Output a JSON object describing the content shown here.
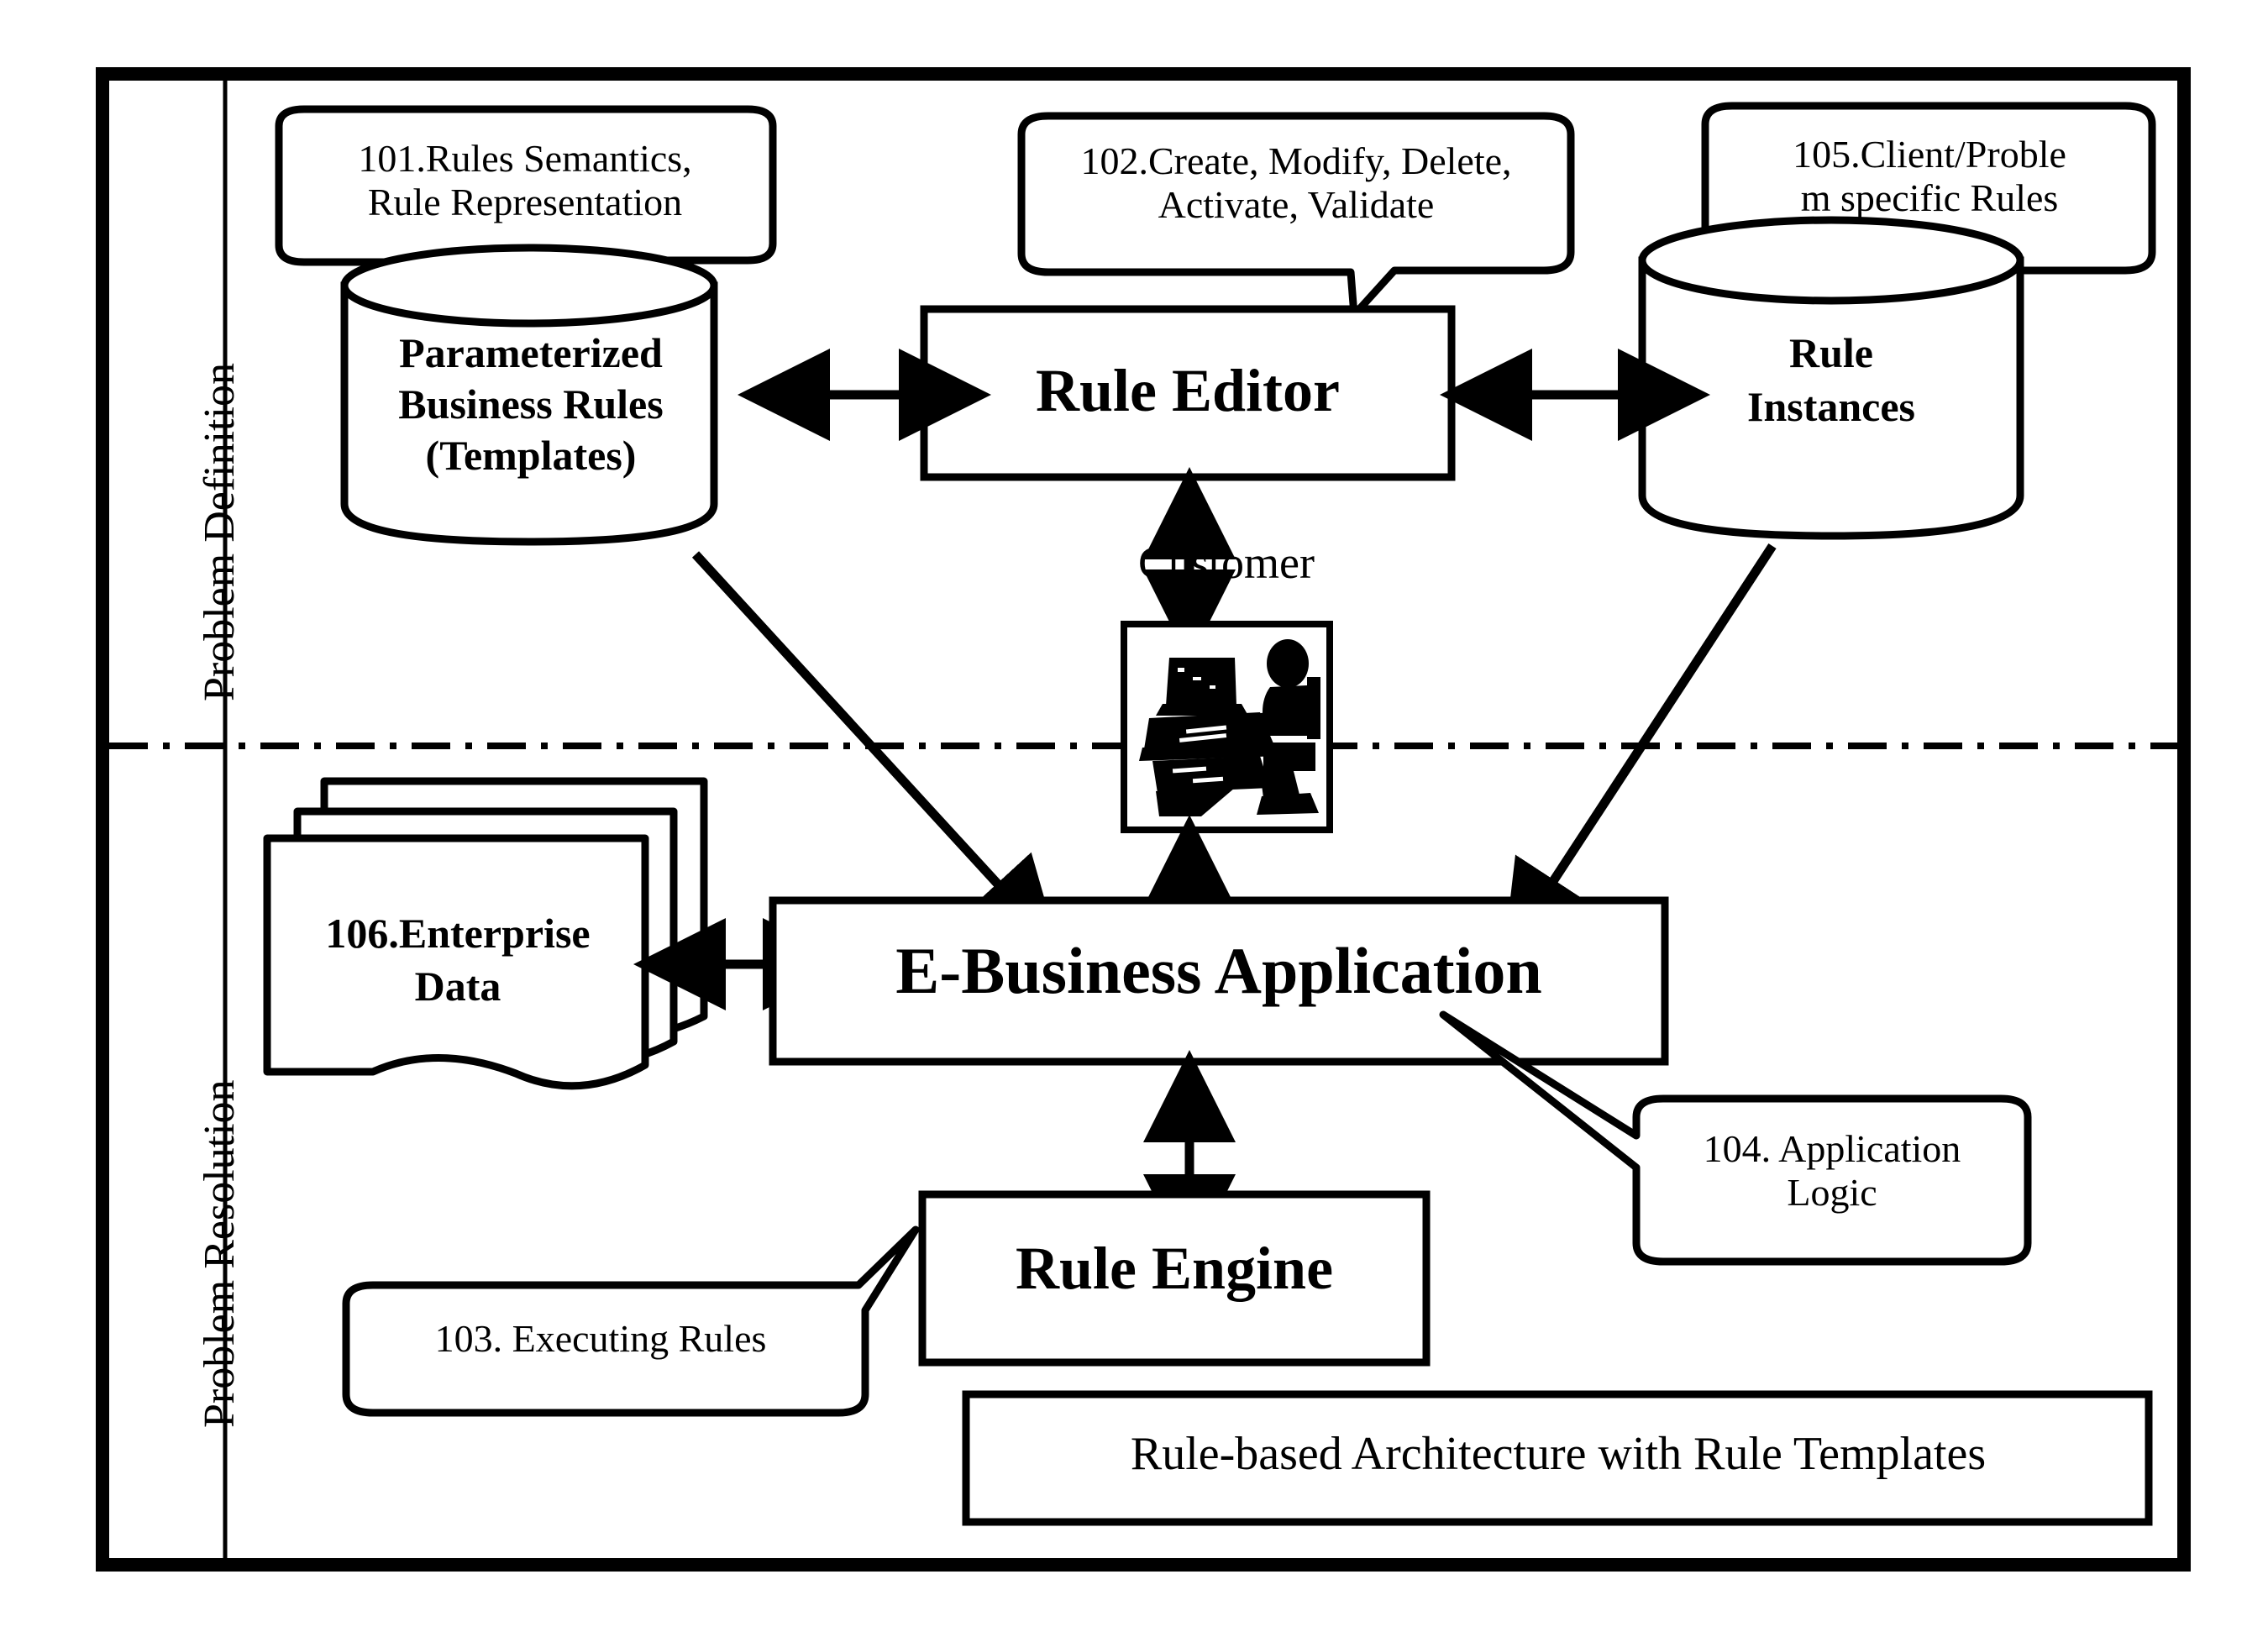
{
  "diagram": {
    "caption": "Rule-based Architecture with Rule Templates",
    "swimlanes": [
      {
        "id": "problem-definition",
        "label": "Problem Definition"
      },
      {
        "id": "problem-resolution",
        "label": "Problem Resolution"
      }
    ],
    "callouts": [
      {
        "id": "101",
        "text": "101.Rules Semantics,\nRule Representation",
        "points_to": "Parameterized Business Rules (Templates)"
      },
      {
        "id": "102",
        "text": "102.Create, Modify, Delete,\nActivate, Validate",
        "points_to": "Rule Editor"
      },
      {
        "id": "105",
        "text": "105.Client/Proble\nm specific Rules",
        "points_to": "Rule Instances"
      },
      {
        "id": "104",
        "text": "104. Application\nLogic",
        "points_to": "E-Business Application"
      },
      {
        "id": "103",
        "text": "103. Executing Rules",
        "points_to": "Rule Engine"
      }
    ],
    "nodes": [
      {
        "id": "parameterized-business-rules",
        "shape": "cylinder",
        "label": "Parameterized\nBusiness Rules\n(Templates)"
      },
      {
        "id": "rule-editor",
        "shape": "rectangle",
        "label": "Rule Editor"
      },
      {
        "id": "rule-instances",
        "shape": "cylinder",
        "label": "Rule\nInstances"
      },
      {
        "id": "customer",
        "shape": "image-box",
        "label": "Customer",
        "icon": "person-at-computer-icon"
      },
      {
        "id": "enterprise-data",
        "shape": "document-stack",
        "label": "106.Enterprise\nData"
      },
      {
        "id": "e-business-application",
        "shape": "rectangle",
        "label": "E-Business  Application"
      },
      {
        "id": "rule-engine",
        "shape": "rectangle",
        "label": "Rule Engine"
      }
    ],
    "connections": [
      {
        "from": "parameterized-business-rules",
        "to": "rule-editor",
        "type": "double-arrow"
      },
      {
        "from": "rule-editor",
        "to": "rule-instances",
        "type": "double-arrow"
      },
      {
        "from": "rule-editor",
        "to": "customer",
        "type": "double-arrow"
      },
      {
        "from": "customer",
        "to": "e-business-application",
        "type": "double-arrow"
      },
      {
        "from": "parameterized-business-rules",
        "to": "e-business-application",
        "type": "single-arrow"
      },
      {
        "from": "rule-instances",
        "to": "e-business-application",
        "type": "single-arrow"
      },
      {
        "from": "enterprise-data",
        "to": "e-business-application",
        "type": "double-arrow"
      },
      {
        "from": "e-business-application",
        "to": "rule-engine",
        "type": "double-arrow"
      }
    ],
    "colors": {
      "stroke": "#000000",
      "fill": "#ffffff",
      "background": "#ffffff"
    }
  }
}
